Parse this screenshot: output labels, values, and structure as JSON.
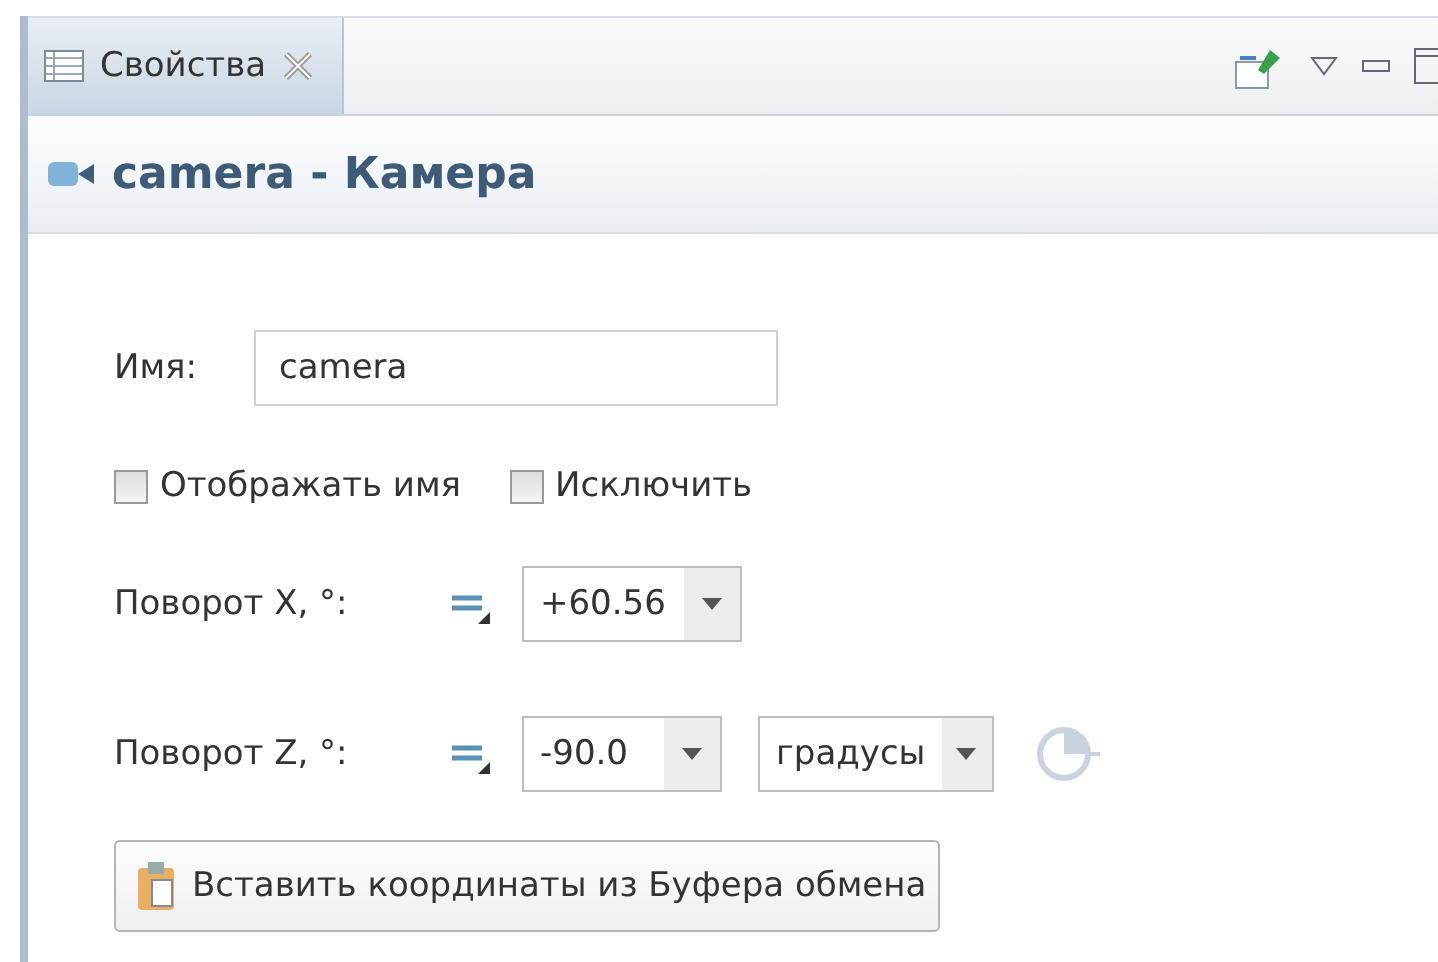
{
  "tabs": [
    {
      "label": "Свойства",
      "selected": true
    }
  ],
  "header": {
    "title": "camera - Камера"
  },
  "name_field": {
    "label": "Имя:",
    "value": "camera"
  },
  "checkboxes": [
    {
      "label": "Отображать имя",
      "checked": false
    },
    {
      "label": "Исключить",
      "checked": false
    }
  ],
  "rotations": [
    {
      "label": "Поворот X, °:",
      "value": "+60.56"
    },
    {
      "label": "Поворот Z, °:",
      "value": "-90.0",
      "units": "градусы"
    }
  ],
  "paste_button": {
    "label": "Вставить координаты из Буфера обмена"
  }
}
